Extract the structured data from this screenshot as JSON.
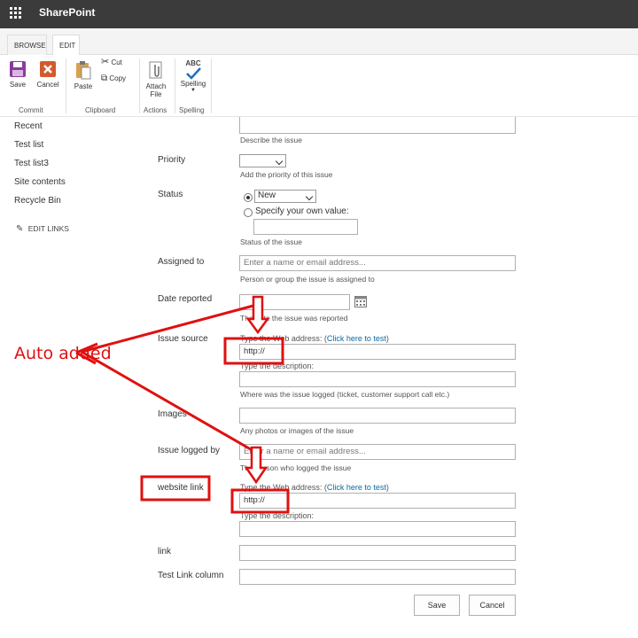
{
  "suite": {
    "app_name": "SharePoint",
    "waffle_icon": "waffle-icon"
  },
  "ribbon": {
    "tabs": [
      {
        "label": "BROWSE"
      },
      {
        "label": "EDIT"
      }
    ],
    "commit": {
      "save": "Save",
      "cancel": "Cancel",
      "group": "Commit"
    },
    "clipboard": {
      "paste": "Paste",
      "cut": "Cut",
      "copy": "Copy",
      "group": "Clipboard"
    },
    "actions": {
      "attach_line1": "Attach",
      "attach_line2": "File",
      "group": "Actions"
    },
    "spelling": {
      "abc": "ABC",
      "label": "Spelling",
      "group": "Spelling"
    }
  },
  "leftnav": {
    "items": [
      "Recent",
      "Test list",
      "Test list3",
      "Site contents",
      "Recycle Bin"
    ],
    "edit_links": "EDIT LINKS"
  },
  "form": {
    "description_hint": "Describe the issue",
    "priority": {
      "label": "Priority",
      "value": "",
      "hint": "Add the priority of this issue"
    },
    "status": {
      "label": "Status",
      "value": "New",
      "option_custom": "Specify your own value:",
      "hint": "Status of the issue"
    },
    "assigned_to": {
      "label": "Assigned to",
      "placeholder": "Enter a name or email address...",
      "hint": "Person or group the issue is assigned to"
    },
    "date_reported": {
      "label": "Date reported",
      "value": "",
      "hint": "The date the issue was reported"
    },
    "issue_source": {
      "label": "Issue source",
      "web_prefix": "Type the Web address: (",
      "test_link": "Click here to test",
      "web_suffix": ")",
      "url_value": "http://",
      "desc_label": "Type the description:",
      "hint": "Where was the issue logged (ticket, customer support call etc.)"
    },
    "images": {
      "label": "Images",
      "hint": "Any photos or images of the issue"
    },
    "issue_logged_by": {
      "label": "Issue logged by",
      "placeholder": "Enter a name or email address...",
      "hint": "The person who logged the issue"
    },
    "website_link": {
      "label": "website link",
      "web_prefix": "Type the Web address: (",
      "test_link": "Click here to test",
      "web_suffix": ")",
      "url_value": "http://",
      "desc_label": "Type the description:"
    },
    "link": {
      "label": "link"
    },
    "test_link_column": {
      "label": "Test Link column"
    },
    "buttons": {
      "save": "Save",
      "cancel": "Cancel"
    }
  },
  "annotation": {
    "text": "Auto added",
    "color": "#e01010"
  },
  "colors": {
    "suite_bar": "#3b3b3b",
    "accent": "#0b6aa2",
    "annotation": "#e01010"
  }
}
